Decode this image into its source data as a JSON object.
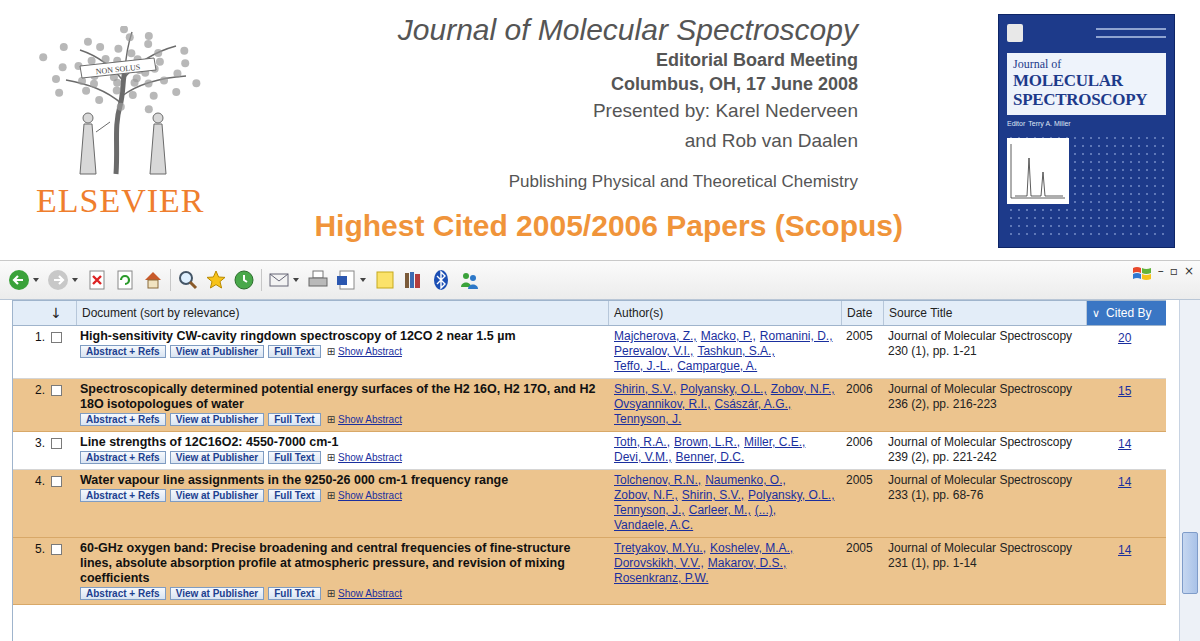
{
  "slide": {
    "journal": "Journal of Molecular Spectroscopy",
    "meeting": "Editorial Board Meeting",
    "place_date": "Columbus, OH, 17 June 2008",
    "presenters": [
      "Presented by: Karel Nederveen",
      "and Rob van Daalen"
    ],
    "tagline": "Publishing Physical and Theoretical Chemistry",
    "heading": "Highest Cited 2005/2006 Papers (Scopus)"
  },
  "logo": {
    "name": "ELSEVIER",
    "motto": "NON SOLUS"
  },
  "cover": {
    "line1": "Journal of",
    "title": [
      "MOLECULAR",
      "SPECTROSCOPY"
    ],
    "editor_label": "Editor",
    "editor": "Terry A. Miller"
  },
  "window_controls": [
    "–",
    "▫",
    "×"
  ],
  "table": {
    "sort_marker": "↓",
    "sorted_marker": "∨",
    "columns": [
      {
        "label": "Document (sort by relevance)",
        "selected": false
      },
      {
        "label": "Author(s)",
        "selected": false
      },
      {
        "label": "Date",
        "selected": false
      },
      {
        "label": "Source Title",
        "selected": false
      },
      {
        "label": "Cited By",
        "selected": true
      }
    ],
    "row_actions": [
      "Abstract + Refs",
      "View at Publisher",
      "Full Text"
    ],
    "abstract_toggle": {
      "icon": "⊞",
      "label": "Show Abstract"
    },
    "rows": [
      {
        "number": "1.",
        "checked": false,
        "highlighted": false,
        "title": "High-sensitivity CW-cavity ringdown spectroscopy of 12CO 2 near 1.5 µm",
        "authors": [
          "Majcherova, Z.,",
          "Macko, P.,",
          "Romanini, D.,",
          "Perevalov, V.I.,",
          "Tashkun, S.A.,",
          "Teffo, J.-L.,",
          "Campargue, A."
        ],
        "date": "2005",
        "source": "Journal of Molecular Spectroscopy 230 (1), pp. 1-21",
        "cited_by": "20"
      },
      {
        "number": "2.",
        "checked": false,
        "highlighted": true,
        "title": "Spectroscopically determined potential energy surfaces of the H2 16O, H2 17O, and H2 18O isotopologues of water",
        "authors": [
          "Shirin, S.V.,",
          "Polyansky, O.L.,",
          "Zobov, N.F.,",
          "Ovsyannikov, R.I.,",
          "Császár, A.G.,",
          "Tennyson, J."
        ],
        "date": "2006",
        "source": "Journal of Molecular Spectroscopy 236 (2), pp. 216-223",
        "cited_by": "15"
      },
      {
        "number": "3.",
        "checked": false,
        "highlighted": false,
        "title": "Line strengths of 12C16O2: 4550-7000 cm-1",
        "authors": [
          "Toth, R.A.,",
          "Brown, L.R.,",
          "Miller, C.E.,",
          "Devi, V.M.,",
          "Benner, D.C."
        ],
        "date": "2006",
        "source": "Journal of Molecular Spectroscopy 239 (2), pp. 221-242",
        "cited_by": "14"
      },
      {
        "number": "4.",
        "checked": false,
        "highlighted": true,
        "title": "Water vapour line assignments in the 9250-26 000 cm-1 frequency range",
        "authors": [
          "Tolchenov, R.N.,",
          "Naumenko, O.,",
          "Zobov, N.F.,",
          "Shirin, S.V.,",
          "Polyansky, O.L.,",
          "Tennyson, J.,",
          "Carleer, M.,",
          "(...),",
          "Vandaele, A.C."
        ],
        "date": "2005",
        "source": "Journal of Molecular Spectroscopy 233 (1), pp. 68-76",
        "cited_by": "14"
      },
      {
        "number": "5.",
        "checked": false,
        "highlighted": true,
        "title": "60-GHz oxygen band: Precise broadening and central frequencies of fine-structure lines, absolute absorption profile at atmospheric pressure, and revision of mixing coefficients",
        "authors": [
          "Tretyakov, M.Yu.,",
          "Koshelev, M.A.,",
          "Dorovskikh, V.V.,",
          "Makarov, D.S.,",
          "Rosenkranz, P.W."
        ],
        "date": "2005",
        "source": "Journal of Molecular Spectroscopy 231 (1), pp. 1-14",
        "cited_by": "14"
      }
    ]
  },
  "scroll": {
    "level": 0.8
  }
}
